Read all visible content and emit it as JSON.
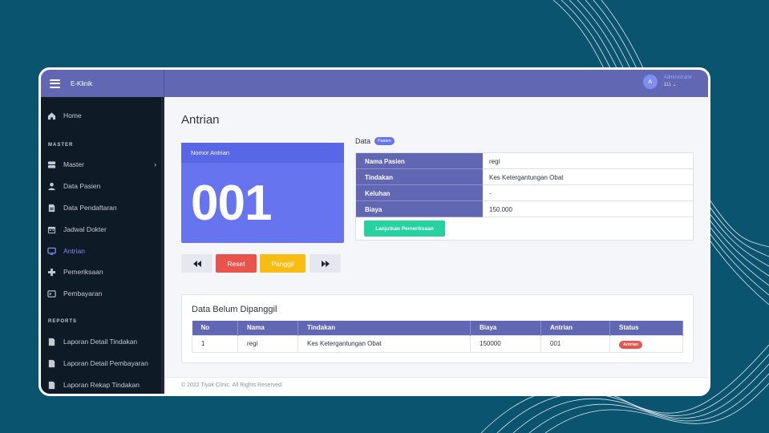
{
  "app": {
    "name": "E-Klinik"
  },
  "user": {
    "avatar_initial": "A",
    "role": "Administrator",
    "id": "111"
  },
  "sidebar": {
    "home": "Home",
    "master_heading": "MASTER",
    "master_items": [
      "Master",
      "Data Pasien",
      "Data Pendaftaran",
      "Jadwal Dokter",
      "Antrian",
      "Pemeriksaan",
      "Pembayaran"
    ],
    "reports_heading": "REPORTS",
    "report_items": [
      "Laporan Detail Tindakan",
      "Laporan Detail Pembayaran",
      "Laporan Rekap Tindakan"
    ],
    "active": "Antrian"
  },
  "page": {
    "title": "Antrian"
  },
  "queue": {
    "header": "Nomor Antrian",
    "number": "001",
    "buttons": {
      "reset": "Reset",
      "call": "Panggil"
    }
  },
  "detail": {
    "title": "Data",
    "badge": "Pasien",
    "rows": [
      {
        "label": "Nama Pasien",
        "value": "regi"
      },
      {
        "label": "Tindakan",
        "value": "Kes Ketergantungan Obat"
      },
      {
        "label": "Keluhan",
        "value": "-"
      },
      {
        "label": "Biaya",
        "value": "150.000"
      }
    ],
    "continue_button": "Lanjutkan Pemeriksaan"
  },
  "pending": {
    "title": "Data Belum Dipanggil",
    "columns": [
      "No",
      "Nama",
      "Tindakan",
      "Biaya",
      "Antrian",
      "Status"
    ],
    "rows": [
      {
        "no": "1",
        "nama": "regi",
        "tindakan": "Kes Ketergantungan Obat",
        "biaya": "150000",
        "antrian": "001",
        "status": "Antrian"
      }
    ]
  },
  "footer": {
    "text": "© 2022 Tiyok Clinic. All Rights Reserved."
  },
  "colors": {
    "background": "#0b5470",
    "topbar": "#6167b3",
    "sidebar": "#0e1a25",
    "queue_card": "#6674f0",
    "reset": "#e8544b",
    "call": "#f7bd12",
    "continue": "#25d3a0"
  }
}
